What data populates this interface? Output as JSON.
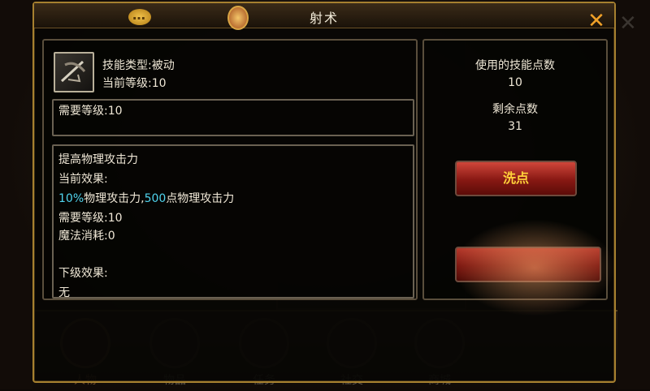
{
  "background": {
    "tabs": [
      "人物",
      "物品",
      "任务",
      "社交",
      "商城"
    ],
    "active_tab": "人物"
  },
  "dialog": {
    "title": "射术",
    "close_label": "✕"
  },
  "skill": {
    "type_text": "技能类型:被动",
    "level_text": "当前等级:10",
    "required_level_text": "需要等级:10",
    "effect": {
      "description": "提高物理攻击力",
      "current_label": "当前效果:",
      "current_part1": "10%",
      "current_part2": "物理攻击力,",
      "current_part3": "500",
      "current_part4": "点物理攻击力",
      "req_level": "需要等级:10",
      "mana_cost": "魔法消耗:0",
      "next_label": "下级效果:",
      "next_value": "无"
    }
  },
  "points": {
    "used_label": "使用的技能点数",
    "used_value": "10",
    "remaining_label": "剩余点数",
    "remaining_value": "31",
    "reset_label": "洗点"
  },
  "colors": {
    "accent_gold": "#a6802f",
    "button_red": "#871813",
    "button_text": "#ffd13a",
    "highlight_cyan": "#4fd4ee"
  }
}
